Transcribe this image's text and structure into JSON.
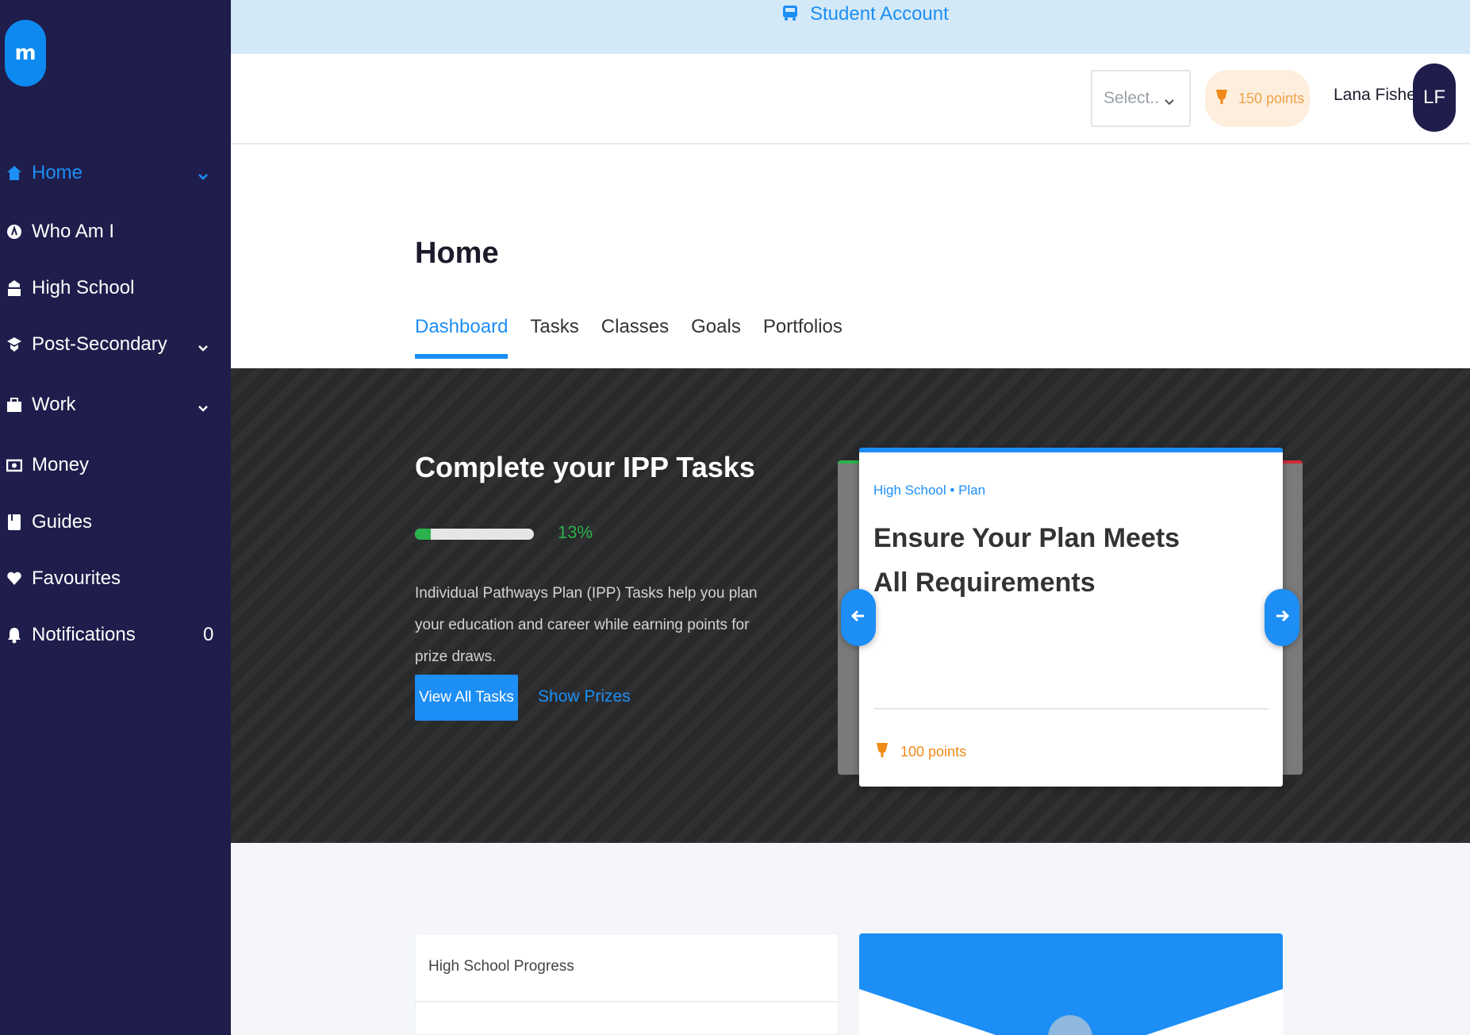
{
  "sidebar": {
    "logo_letter": "m",
    "items": [
      {
        "label": "Home",
        "icon": "home-icon",
        "active": true
      },
      {
        "label": "Who Am I",
        "icon": "person-circle-icon"
      },
      {
        "label": "High School",
        "icon": "school-icon"
      },
      {
        "label": "Post-Secondary",
        "icon": "graduation-cap-icon"
      },
      {
        "label": "Work",
        "icon": "briefcase-icon"
      },
      {
        "label": "Money",
        "icon": "money-icon"
      },
      {
        "label": "Guides",
        "icon": "book-icon"
      },
      {
        "label": "Favourites",
        "icon": "heart-icon"
      },
      {
        "label": "Notifications",
        "icon": "bell-icon",
        "count": "0"
      }
    ]
  },
  "banner": {
    "label": "Student Account",
    "icon": "bus-icon"
  },
  "header": {
    "select_placeholder": "Select..",
    "points_label": "150 points",
    "user_name": "Lana Fisher",
    "avatar_initials": "LF"
  },
  "page": {
    "title": "Home",
    "tabs": [
      "Dashboard",
      "Tasks",
      "Classes",
      "Goals",
      "Portfolios"
    ],
    "active_tab": "Dashboard"
  },
  "hero": {
    "title": "Complete your IPP Tasks",
    "progress_percent": 13,
    "progress_text": "13%",
    "description": "Individual Pathways Plan (IPP) Tasks help you plan your education and career while earning points for prize draws.",
    "primary_button": "View All Tasks",
    "secondary_link": "Show Prizes"
  },
  "task_card": {
    "category": "High School • Plan",
    "title": "Ensure Your Plan Meets All Requirements",
    "points": "100 points"
  },
  "lower": {
    "progress_panel_title": "High School Progress"
  },
  "colors": {
    "sidebar_bg": "#1f1d4b",
    "accent": "#1c8ef5",
    "success": "#2bb24c",
    "points": "#f08a18"
  }
}
